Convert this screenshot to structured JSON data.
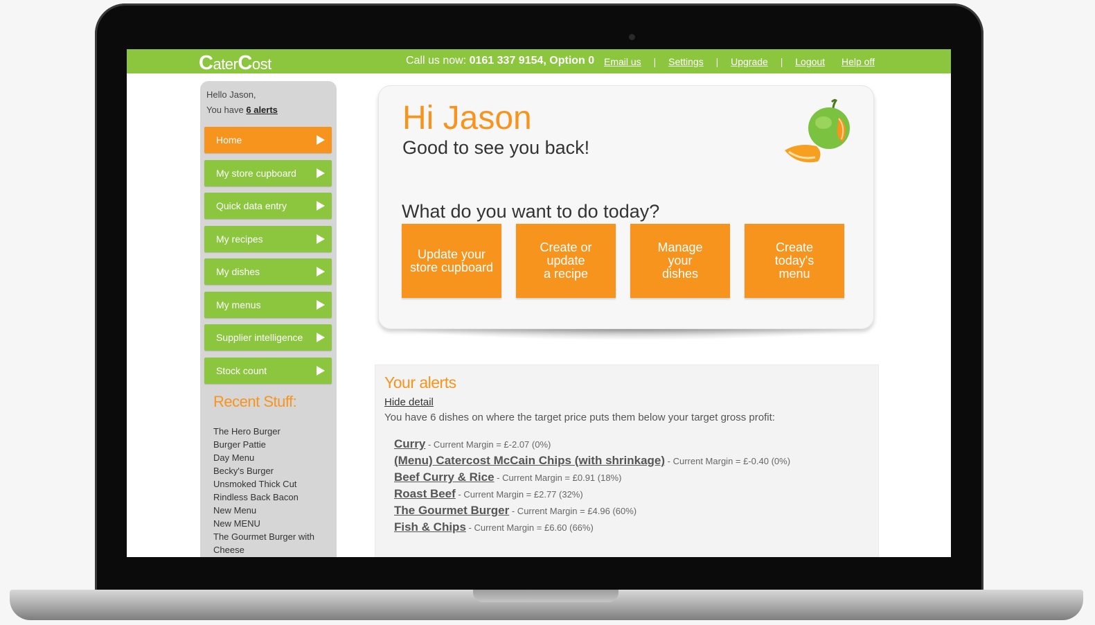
{
  "header": {
    "logo_part1": "ater",
    "logo_c1": "C",
    "logo_c2": "C",
    "logo_part2": "ost",
    "call_label": "Call us now:",
    "phone": "0161 337 9154, Option 0",
    "links": {
      "email": "Email us",
      "settings": "Settings",
      "upgrade": "Upgrade",
      "logout": "Logout",
      "help": "Help off"
    },
    "separator": "|"
  },
  "sidebar": {
    "hello": "Hello Jason,",
    "you_have": "You have",
    "alerts_link": "6 alerts",
    "items": [
      {
        "label": "Home"
      },
      {
        "label": "My store cupboard"
      },
      {
        "label": "Quick data entry"
      },
      {
        "label": "My recipes"
      },
      {
        "label": "My dishes"
      },
      {
        "label": "My menus"
      },
      {
        "label": "Supplier intelligence"
      },
      {
        "label": "Stock count"
      }
    ],
    "recent_title": "Recent Stuff:",
    "recent": [
      "The Hero Burger",
      "Burger Pattie",
      "Day Menu",
      "Becky's Burger",
      "Unsmoked Thick Cut",
      "Rindless Back Bacon",
      "New Menu",
      "New MENU",
      "The Gourmet Burger with Cheese"
    ]
  },
  "welcome": {
    "hi": "Hi Jason",
    "good": "Good to see you back!",
    "question": "What do you want to do today?",
    "actions": [
      {
        "line1": "Update your",
        "line2": "store cupboard",
        "line3": ""
      },
      {
        "line1": "Create or",
        "line2": "update",
        "line3": "a recipe"
      },
      {
        "line1": "Manage",
        "line2": "your",
        "line3": "dishes"
      },
      {
        "line1": "Create",
        "line2": "today's",
        "line3": "menu"
      }
    ]
  },
  "alerts": {
    "title": "Your alerts",
    "hide": "Hide detail",
    "description": "You have 6 dishes on where the target price puts them below your target gross profit:",
    "items": [
      {
        "name": "Curry",
        "margin": " - Current Margin = £-2.07 (0%)"
      },
      {
        "name": "(Menu) Catercost McCain Chips (with shrinkage)",
        "margin": " - Current Margin = £-0.40 (0%)"
      },
      {
        "name": "Beef Curry & Rice",
        "margin": " - Current Margin = £0.91 (18%)"
      },
      {
        "name": "Roast Beef",
        "margin": " - Current Margin = £2.77 (32%)"
      },
      {
        "name": "The Gourmet Burger",
        "margin": " - Current Margin = £4.96 (60%)"
      },
      {
        "name": "Fish & Chips",
        "margin": " - Current Margin = £6.60 (66%)"
      }
    ]
  },
  "colors": {
    "brand_green": "#8cc63f",
    "brand_orange": "#f7941e"
  }
}
